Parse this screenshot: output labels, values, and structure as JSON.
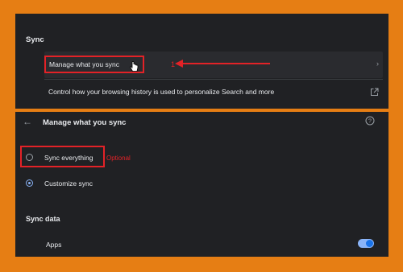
{
  "sync_section": {
    "title": "Sync",
    "manage_row_label": "Manage what you sync",
    "control_history_text": "Control how your browsing history is used to personalize Search and more",
    "annotation_number": "1"
  },
  "manage_page": {
    "title": "Manage what you sync",
    "options": [
      {
        "label": "Sync everything",
        "selected": false
      },
      {
        "label": "Customize sync",
        "selected": true
      }
    ],
    "optional_note": "Optional",
    "sync_data_title": "Sync data",
    "items": [
      {
        "label": "Apps",
        "enabled": true
      }
    ]
  },
  "icons": {
    "chevron": "chevron-right-icon",
    "external": "open-in-new-icon",
    "back": "back-arrow-icon",
    "help": "help-icon",
    "cursor": "hand-pointer-icon"
  },
  "colors": {
    "background_frame": "#e67e14",
    "panel": "#202124",
    "annotation": "#e32227",
    "accent": "#8ab4f8"
  }
}
